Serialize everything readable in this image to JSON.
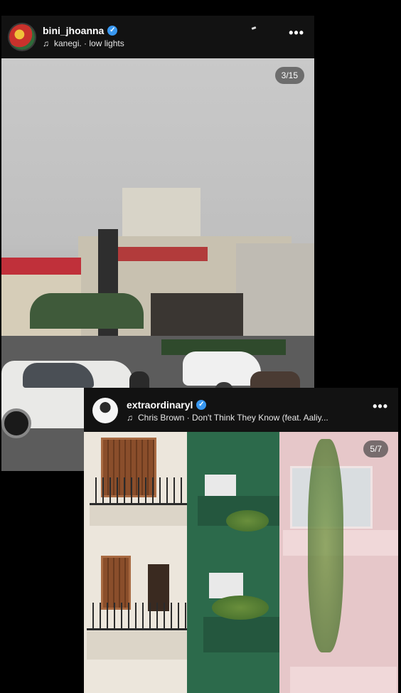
{
  "posts": [
    {
      "username": "bini_jhoanna",
      "song": "kanegi. · low lights",
      "counter": "3/15",
      "icons": {
        "verified": "verified-badge-icon",
        "music": "music-note-icon",
        "more": "more-options-icon"
      }
    },
    {
      "username": "extraordinaryl",
      "song": "Chris Brown · Don't Think They Know (feat. Aaliy...",
      "counter": "5/7",
      "icons": {
        "verified": "verified-badge-icon",
        "music": "music-note-icon",
        "more": "more-options-icon"
      }
    }
  ],
  "colors": {
    "background": "#000000",
    "card": "#121212",
    "verified": "#3897f0"
  }
}
